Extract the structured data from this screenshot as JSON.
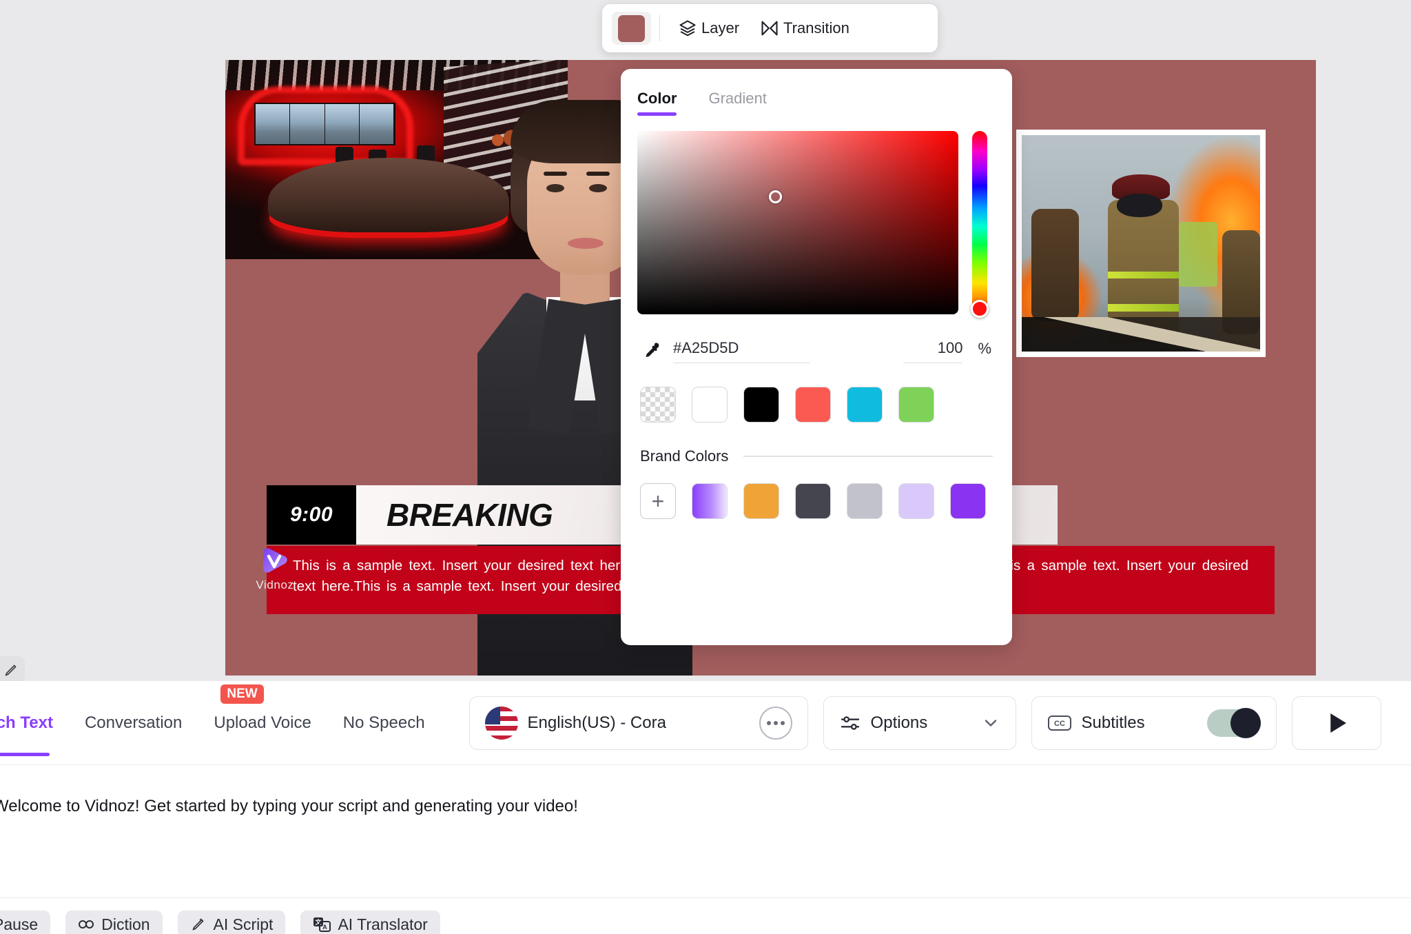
{
  "top_toolbar": {
    "color_swatch_value": "#a25d5d",
    "layer_label": "Layer",
    "transition_label": "Transition"
  },
  "color_picker": {
    "tabs": [
      {
        "label": "Color",
        "active": true
      },
      {
        "label": "Gradient",
        "active": false
      }
    ],
    "hex_value": "#A25D5D",
    "alpha_value": "100",
    "alpha_unit": "%",
    "accent_color": "#8a3ffc",
    "swatches": [
      {
        "name": "transparent",
        "color": "transparent"
      },
      {
        "name": "white",
        "color": "#ffffff"
      },
      {
        "name": "black",
        "color": "#000000"
      },
      {
        "name": "red",
        "color": "#fb5a52"
      },
      {
        "name": "cyan",
        "color": "#0fbce0"
      },
      {
        "name": "green",
        "color": "#7dd257"
      }
    ],
    "brand_colors_label": "Brand Colors",
    "brand_add_label": "+",
    "brand_swatches": [
      {
        "name": "purple-gradient",
        "color": "linear-gradient(90deg,#8a3ffc 0%, #b78bfd 55%, #efe6ff 100%)"
      },
      {
        "name": "orange",
        "color": "#f0a437"
      },
      {
        "name": "dark-slate",
        "color": "#45454f"
      },
      {
        "name": "light-gray",
        "color": "#c2c2cc"
      },
      {
        "name": "pale-lavender",
        "color": "#d9c9fb"
      },
      {
        "name": "solid-purple",
        "color": "#8a33f0"
      }
    ]
  },
  "canvas": {
    "background_color": "#a25d5d",
    "lower_third_time": "9:00",
    "lower_third_title": "BREAKING",
    "subtitle_text": "This is a sample text. Insert your desired text here.This is a sample text. Insert your desired text here. This is a sample text. Insert your desired text here.This is a sample text. Insert your desired text here.",
    "watermark_text": "Vidnoz"
  },
  "bottom_panel": {
    "tabs": [
      {
        "label": "eech Text",
        "active": true,
        "badge": null
      },
      {
        "label": "Conversation",
        "active": false,
        "badge": null
      },
      {
        "label": "Upload Voice",
        "active": false,
        "badge": "NEW"
      },
      {
        "label": "No Speech",
        "active": false,
        "badge": null
      }
    ],
    "voice": {
      "label": "English(US) - Cora",
      "flag": "us-flag-icon"
    },
    "options": {
      "label": "Options"
    },
    "subtitles": {
      "label": "Subtitles",
      "enabled": true
    },
    "script_text": "Welcome to Vidnoz! Get started by typing your script and generating your video!",
    "tools": [
      {
        "label": "Pause",
        "icon": null
      },
      {
        "label": "Diction",
        "icon": "diction-icon"
      },
      {
        "label": "AI Script",
        "icon": "ai-script-icon"
      },
      {
        "label": "AI Translator",
        "icon": "ai-translator-icon"
      }
    ]
  }
}
